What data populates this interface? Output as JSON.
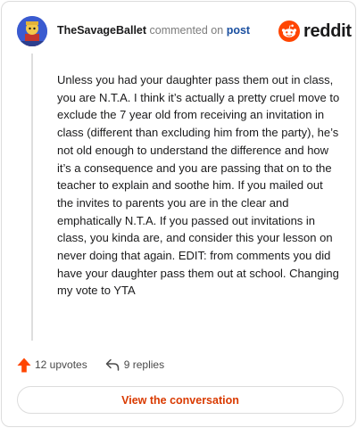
{
  "header": {
    "author": "TheSavageBallet",
    "action_text": "commented on",
    "post_link": "post",
    "logo_text": "reddit"
  },
  "comment": {
    "body": "Unless you had your daughter pass them out in class, you are N.T.A. I think it’s actually a pretty cruel move to exclude the 7 year old from receiving an invitation in class (different than excluding him from the party), he’s not old enough to understand the difference and how it’s a consequence and you are passing that on to the teacher to explain and soothe him. If you mailed out the invites to parents you are in the clear and emphatically N.T.A. If you passed out invitations in class, you kinda are, and consider this your lesson on never doing that again. EDIT: from comments you did have your daughter pass them out at school. Changing my vote to YTA"
  },
  "footer": {
    "upvotes": "12 upvotes",
    "replies": "9 replies",
    "view_button": "View the conversation"
  },
  "colors": {
    "accent": "#ff4500",
    "link": "#1a4fa0",
    "button_text": "#d93a00"
  },
  "icons": {
    "avatar": "user-avatar",
    "logo": "reddit-logo-icon",
    "upvote": "upvote-arrow-icon",
    "reply": "reply-arrow-icon"
  }
}
